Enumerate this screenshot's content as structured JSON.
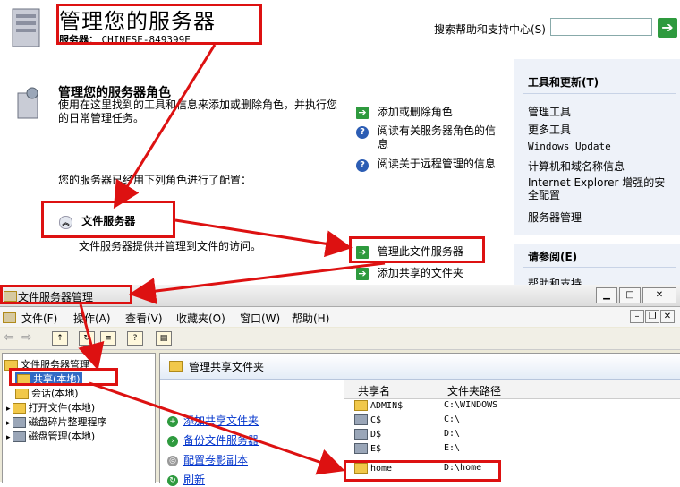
{
  "header": {
    "title": "管理您的服务器",
    "server_label": "服务器：",
    "server_name": "CHINESE-849399E",
    "search_label": "搜索帮助和支持中心(S)",
    "search_value": "",
    "go_icon": "arrow-right-icon"
  },
  "roles": {
    "heading": "管理您的服务器角色",
    "description": "使用在这里找到的工具和信息来添加或删除角色，并执行您的日常管理任务。",
    "configured_text": "您的服务器已经用下列角色进行了配置：",
    "actions": [
      "添加或删除角色",
      "阅读有关服务器角色的信息",
      "阅读关于远程管理的信息"
    ],
    "file_server": {
      "title": "文件服务器",
      "description": "文件服务器提供并管理到文件的访问。",
      "manage_link": "管理此文件服务器",
      "add_share_link": "添加共享的文件夹"
    }
  },
  "right_pane": {
    "tools_heading": "工具和更新(T)",
    "tools": [
      "管理工具",
      "更多工具",
      "Windows Update",
      "计算机和域名称信息",
      "Internet Explorer 增强的安全配置",
      "服务器管理"
    ],
    "see_also_heading": "请参阅(E)",
    "see_also_partial": "帮助和支持"
  },
  "window": {
    "title": "文件服务器管理",
    "menu": [
      "文件(F)",
      "操作(A)",
      "查看(V)",
      "收藏夹(O)",
      "窗口(W)",
      "帮助(H)"
    ],
    "tree": {
      "root": "文件服务器管理",
      "items": [
        "共享(本地)",
        "会话(本地)",
        "打开文件(本地)",
        "磁盘碎片整理程序",
        "磁盘管理(本地)"
      ]
    },
    "content_title": "管理共享文件夹",
    "tasks": [
      "添加共享文件夹",
      "备份文件服务器",
      "配置卷影副本",
      "刷新"
    ],
    "columns": [
      "共享名",
      "文件夹路径"
    ],
    "shares": [
      {
        "name": "ADMIN$",
        "path": "C:\\WINDOWS"
      },
      {
        "name": "C$",
        "path": "C:\\"
      },
      {
        "name": "D$",
        "path": "D:\\"
      },
      {
        "name": "E$",
        "path": "E:\\"
      },
      {
        "name": "home",
        "path": "D:\\home"
      }
    ]
  },
  "colors": {
    "annotation_red": "#dd1111",
    "accent_green": "#2e9a3e",
    "sidebar_bg": "#eef2f9"
  }
}
